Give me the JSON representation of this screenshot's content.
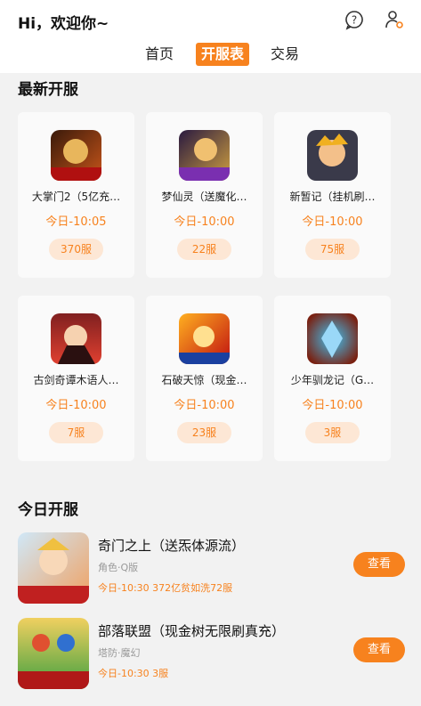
{
  "header": {
    "greeting": "Hi，欢迎你~",
    "icons": [
      "help-icon",
      "user-settings-icon"
    ],
    "tabs": [
      {
        "label": "首页",
        "active": false
      },
      {
        "label": "开服表",
        "active": true
      },
      {
        "label": "交易",
        "active": false
      }
    ]
  },
  "latest": {
    "title": "最新开服",
    "cards": [
      {
        "name": "大掌门2（5亿充…",
        "time": "今日-10:05",
        "badge": "370服"
      },
      {
        "name": "梦仙灵（送魔化…",
        "time": "今日-10:00",
        "badge": "22服"
      },
      {
        "name": "新暂记（挂机刷…",
        "time": "今日-10:00",
        "badge": "75服"
      },
      {
        "name": "古剑奇谭木语人…",
        "time": "今日-10:00",
        "badge": "7服"
      },
      {
        "name": "石破天惊（现金…",
        "time": "今日-10:00",
        "badge": "23服"
      },
      {
        "name": "少年驯龙记（G…",
        "time": "今日-10:00",
        "badge": "3服"
      }
    ]
  },
  "today": {
    "title": "今日开服",
    "items": [
      {
        "name": "奇门之上（送炁体源流）",
        "tags": "角色·Q版",
        "info": "今日-10:30 372亿贫如洗72服",
        "button": "查看"
      },
      {
        "name": "部落联盟（现金树无限刷真充）",
        "tags": "塔防·魔幻",
        "info": "今日-10:30 3服",
        "button": "查看"
      }
    ]
  },
  "colors": {
    "accent": "#f7821e",
    "badge_bg": "#fde7d5",
    "background": "#f2f2f2"
  }
}
